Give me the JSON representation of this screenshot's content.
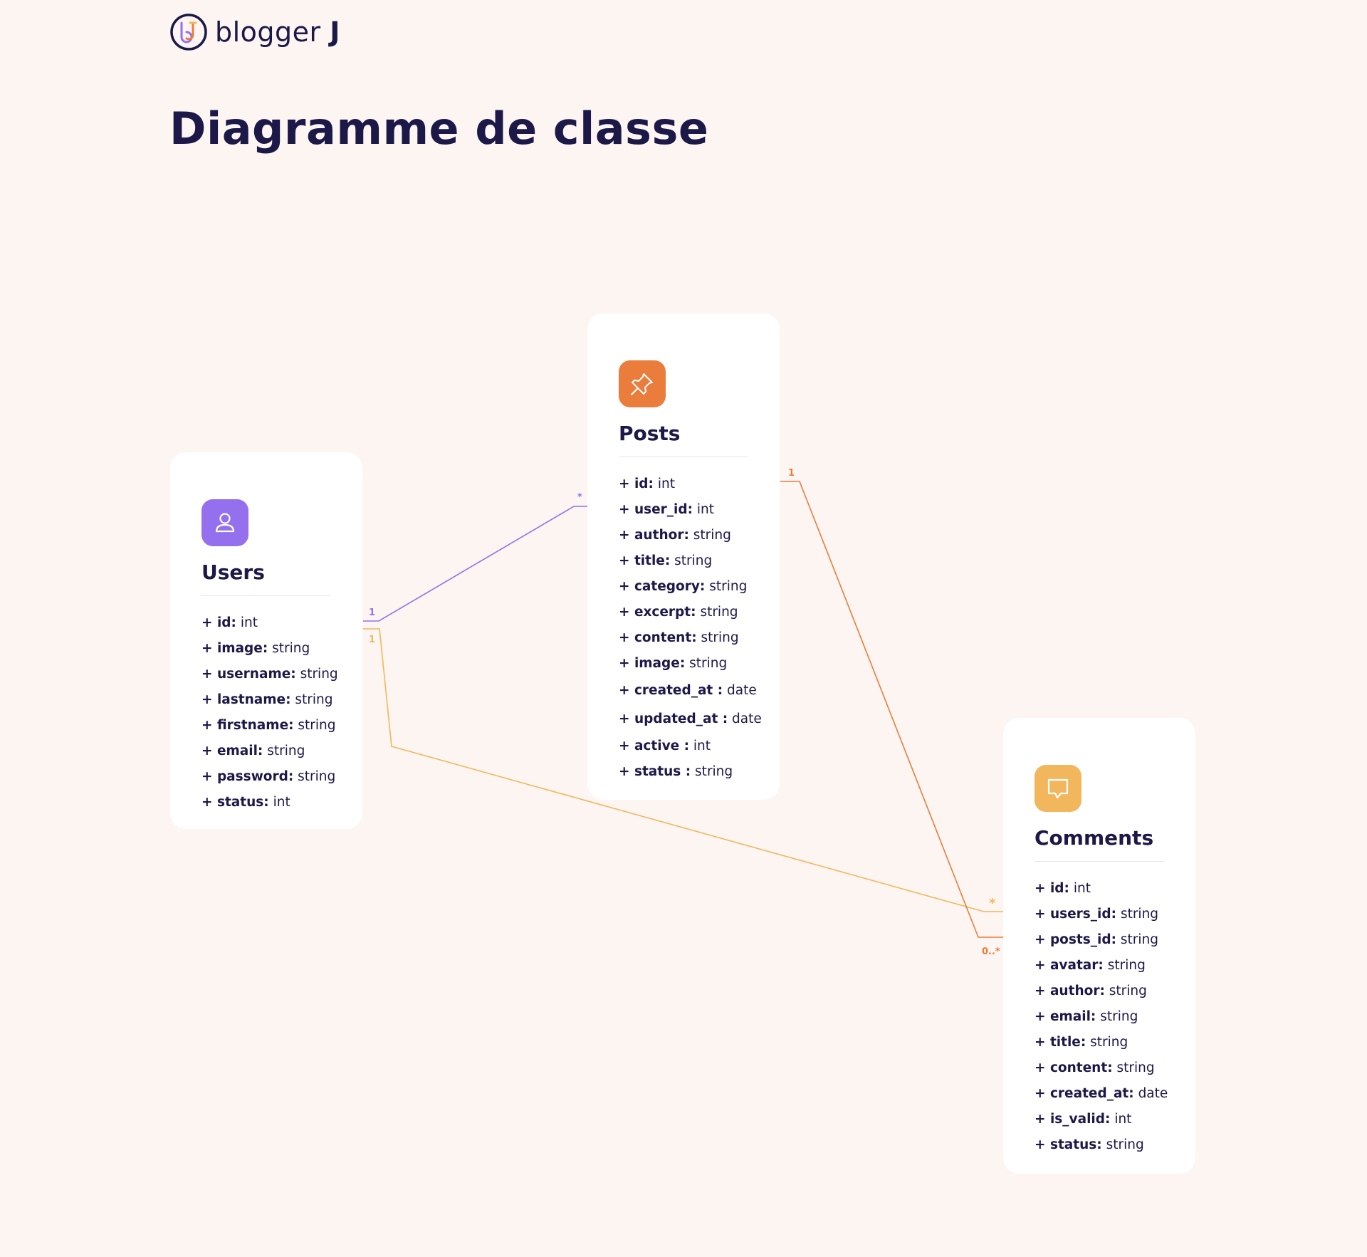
{
  "brand": {
    "name": "blogger",
    "initial": "J"
  },
  "page_title": "Diagramme de classe",
  "colors": {
    "background": "#fcf5f1",
    "text": "#1c1848",
    "users_accent": "#9470ee",
    "posts_accent": "#ea7d3c",
    "comments_accent": "#f2b75c"
  },
  "classes": {
    "users": {
      "title": "Users",
      "icon": "user-icon",
      "attributes": [
        {
          "name": "+ id:",
          "type": "int"
        },
        {
          "name": "+ image:",
          "type": "string"
        },
        {
          "name": "+ username:",
          "type": "string"
        },
        {
          "name": "+ lastname:",
          "type": "string"
        },
        {
          "name": "+ firstname:",
          "type": "string"
        },
        {
          "name": "+ email:",
          "type": "string"
        },
        {
          "name": "+ password:",
          "type": "string"
        },
        {
          "name": "+ status:",
          "type": "int"
        }
      ]
    },
    "posts": {
      "title": "Posts",
      "icon": "pushpin-icon",
      "attributes": [
        {
          "name": "+ id:",
          "type": "int"
        },
        {
          "name": "+ user_id:",
          "type": "int"
        },
        {
          "name": "+ author:",
          "type": "string"
        },
        {
          "name": "+ title:",
          "type": "string"
        },
        {
          "name": "+ category:",
          "type": "string"
        },
        {
          "name": "+ excerpt:",
          "type": "string"
        },
        {
          "name": "+ content:",
          "type": "string"
        },
        {
          "name": "+ image:",
          "type": "string"
        },
        {
          "name": "+ created_at :",
          "type": "date"
        },
        {
          "name": "+ updated_at :",
          "type": "date"
        },
        {
          "name": "+ active :",
          "type": "int"
        },
        {
          "name": "+ status :",
          "type": "string"
        }
      ]
    },
    "comments": {
      "title": "Comments",
      "icon": "comment-icon",
      "attributes": [
        {
          "name": "+ id:",
          "type": "int"
        },
        {
          "name": "+ users_id:",
          "type": "string"
        },
        {
          "name": "+ posts_id:",
          "type": "string"
        },
        {
          "name": "+ avatar:",
          "type": "string"
        },
        {
          "name": "+ author:",
          "type": "string"
        },
        {
          "name": "+ email:",
          "type": "string"
        },
        {
          "name": "+ title:",
          "type": "string"
        },
        {
          "name": "+ content:",
          "type": "string"
        },
        {
          "name": "+ created_at:",
          "type": "date"
        },
        {
          "name": "+ is_valid:",
          "type": "int"
        },
        {
          "name": "+ status:",
          "type": "string"
        }
      ]
    }
  },
  "relations": [
    {
      "from": "Users",
      "to": "Posts",
      "from_mult": "1",
      "to_mult": "*"
    },
    {
      "from": "Users",
      "to": "Comments",
      "from_mult": "1",
      "to_mult": "*"
    },
    {
      "from": "Posts",
      "to": "Comments",
      "from_mult": "1",
      "to_mult": "0..*"
    }
  ]
}
